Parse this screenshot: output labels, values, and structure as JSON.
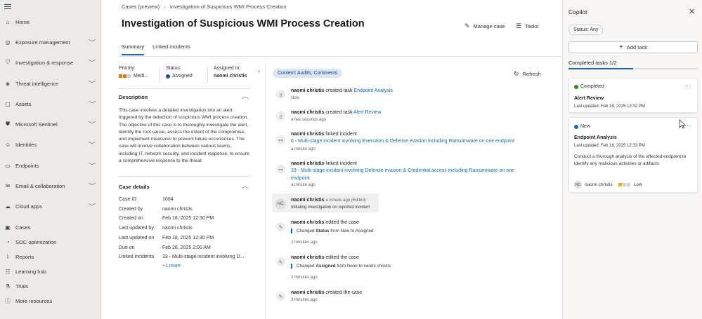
{
  "sidebar": {
    "items": [
      {
        "label": "Home",
        "icon": "home-icon",
        "glyph": "⌂",
        "chevron": false
      },
      {
        "label": "Exposure management",
        "icon": "exposure-icon",
        "glyph": "◎",
        "chevron": true
      },
      {
        "label": "Investigation & response",
        "icon": "shield-icon",
        "glyph": "⛉",
        "chevron": true
      },
      {
        "label": "Threat intelligence",
        "icon": "threat-icon",
        "glyph": "◈",
        "chevron": true
      },
      {
        "label": "Assets",
        "icon": "assets-icon",
        "glyph": "▢",
        "chevron": true
      },
      {
        "label": "Microsoft Sentinel",
        "icon": "sentinel-icon",
        "glyph": "⛊",
        "chevron": true
      },
      {
        "label": "Identities",
        "icon": "identities-icon",
        "glyph": "☺",
        "chevron": true
      },
      {
        "label": "Endpoints",
        "icon": "endpoints-icon",
        "glyph": "▭",
        "chevron": true
      },
      {
        "label": "Email & collaboration",
        "icon": "mail-icon",
        "glyph": "✉",
        "chevron": true
      },
      {
        "label": "Cloud apps",
        "icon": "cloud-icon",
        "glyph": "☁",
        "chevron": true
      },
      {
        "label": "Cases",
        "icon": "cases-icon",
        "glyph": "▣",
        "chevron": false
      },
      {
        "label": "SOC optimization",
        "icon": "soc-icon",
        "glyph": "◔",
        "chevron": false
      },
      {
        "label": "Reports",
        "icon": "reports-icon",
        "glyph": "⌇",
        "chevron": false
      },
      {
        "label": "Learning hub",
        "icon": "learning-icon",
        "glyph": "☷",
        "chevron": false
      },
      {
        "label": "Trials",
        "icon": "trials-icon",
        "glyph": "⚗",
        "chevron": false
      },
      {
        "label": "More resources",
        "icon": "info-icon",
        "glyph": "ⓘ",
        "chevron": false
      }
    ]
  },
  "breadcrumb": {
    "root": "Cases (preview)",
    "current": "Investigation of Suspicious WMI Process Creation"
  },
  "page": {
    "title": "Investigation of Suspicious WMI Process Creation",
    "manage_case": "Manage case",
    "tasks": "Tasks",
    "tabs": [
      "Summary",
      "Linked incidents"
    ]
  },
  "meta": {
    "priority_label": "Priority:",
    "priority_value": "Medi...",
    "status_label": "Status:",
    "status_value": "Assigned",
    "assigned_label": "Assigned to:",
    "assigned_value": "naomi christis"
  },
  "description": {
    "heading": "Description",
    "text": "This case involves a detailed investigation into an alert triggered by the detection of suspicious WMI process creation. The objective of this case is to thoroughly investigate the alert, identify the root cause, assess the extent of the compromise, and implement measures to prevent future occurrences. The case will involve collaboration between various teams, including IT, network security, and incident response, to ensure a comprehensive response to the threat."
  },
  "case_details": {
    "heading": "Case details",
    "rows": [
      {
        "k": "Case ID",
        "v": "1004"
      },
      {
        "k": "Created by",
        "v": "naomi christis"
      },
      {
        "k": "Created on",
        "v": "Feb 18, 2025 12:30 PM"
      },
      {
        "k": "Last updated by",
        "v": "naomi christis"
      },
      {
        "k": "Last updated on",
        "v": "Feb 18, 2025 12:30 PM"
      },
      {
        "k": "Due on",
        "v": "Feb 26, 2025 2:00 AM"
      },
      {
        "k": "Linked incidents",
        "v": "33 - Multi-stage incident involving D..."
      }
    ],
    "more": "+1 more"
  },
  "feed": {
    "filter": "Content: Audits, Comments",
    "refresh": "Refresh",
    "items": [
      {
        "actor": "naomi christis",
        "action": " created task ",
        "link": "Endpoint Analysis",
        "time": "Now"
      },
      {
        "actor": "naomi christis",
        "action": " created task ",
        "link": "Alert Review",
        "time": "a few seconds ago"
      },
      {
        "actor": "naomi christis",
        "action": " linked incident",
        "detail": "6 - Multi-stage incident involving Execution & Defense evasion including Ransomware on one endpoint",
        "time": "a minute ago"
      },
      {
        "actor": "naomi christis",
        "action": " linked incident",
        "detail": "33 - Multi-stage incident involving Defense evasion & Credential access including Ransomware on one endpoint",
        "time": "a minute ago"
      },
      {
        "actor": "naomi christis",
        "initials": "NC",
        "comment_meta": "a minute ago (Edited)",
        "comment": "Initiating investigation on reported incident"
      },
      {
        "actor": "naomi christis",
        "action": " edited the case",
        "change_prefix": "Changed ",
        "change_field": "Status",
        "change_rest": " from New to Assigned",
        "time": "2 minutes ago"
      },
      {
        "actor": "naomi christis",
        "action": " edited the case",
        "change_prefix": "Changed ",
        "change_field": "Assigned",
        "change_rest": " from None to naomi christis",
        "time": "2 minutes ago"
      },
      {
        "actor": "naomi christis",
        "action": " created the case",
        "time": "3 minutes ago"
      }
    ]
  },
  "copilot": {
    "title": "Copilot",
    "status_filter": "Status: Any",
    "add_task": "Add task",
    "completed_label": "Completed tasks 1/2",
    "progress": 0.5,
    "cards": [
      {
        "status": "Completed",
        "status_color": "#13a10e",
        "title": "Alert Review",
        "updated": "Last updated: Feb 18, 2025 12:32 PM"
      },
      {
        "status": "New",
        "status_color": "#0f6cbd",
        "title": "Endpoint Analysis",
        "updated": "Last updated: Feb 18, 2025 12:33 PM",
        "desc": "Conduct a thorough analysis of the affected endpoint to identify any malicious activities or artifacts.",
        "owner_initials": "NC",
        "owner": "naomi christis",
        "priority": "Low"
      }
    ]
  },
  "colors": {
    "accent": "#0f6cbd",
    "priority_orange": "#e8741a",
    "priority_low": "#e8b41a"
  }
}
